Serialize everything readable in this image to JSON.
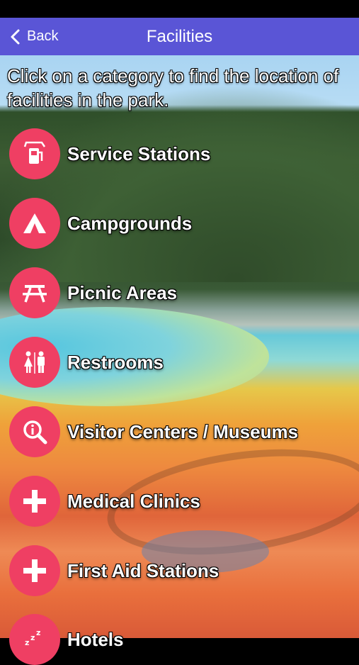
{
  "nav": {
    "back_label": "Back",
    "title": "Facilities"
  },
  "instructions": "Click on a category to find the location of facilities in the park.",
  "categories": [
    {
      "label": "Service Stations",
      "icon": "fuel-pump-icon"
    },
    {
      "label": "Campgrounds",
      "icon": "tent-icon"
    },
    {
      "label": "Picnic Areas",
      "icon": "picnic-table-icon"
    },
    {
      "label": "Restrooms",
      "icon": "restroom-icon"
    },
    {
      "label": "Visitor Centers / Museums",
      "icon": "info-magnifier-icon"
    },
    {
      "label": "Medical Clinics",
      "icon": "medical-cross-icon"
    },
    {
      "label": "First Aid Stations",
      "icon": "first-aid-cross-icon"
    },
    {
      "label": "Hotels",
      "icon": "sleep-zzz-icon"
    }
  ],
  "colors": {
    "nav_bar": "#5a55d6",
    "category_circle": "#ef3f63"
  }
}
